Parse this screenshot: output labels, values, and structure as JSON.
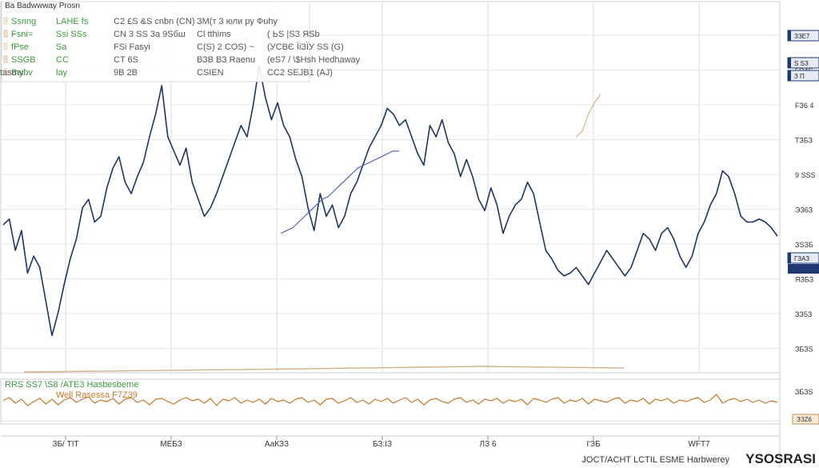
{
  "header": {
    "title": "Ba Badwwway Prosn",
    "legend_rows": [
      [
        "Ssnng",
        "LAHE fs",
        "C2 £S &S cnbn (CN)",
        "ЗМ(т 3 юли ру Фuhy"
      ],
      [
        "Fsni=",
        "Ssi SSs",
        "CN 3 SS 3a 9Sбш",
        "Cl tthims",
        "( ЬS |SЗ ЯSb"
      ],
      [
        "fPse",
        "Sa",
        "FSi Fasyi",
        "C(S) 2 COS) ~",
        "(УСВЄ ЇіЗЇУ SS (G)"
      ],
      [
        "SSGB",
        "CC",
        "CT 6S",
        "ВЗВ ВЗ Raenu",
        "(eS7 / \\$Hsh Hedhaway"
      ],
      [
        "Bsibv",
        "lay",
        "9B 2B",
        "CSIEN",
        "CC2 SEJB1 (AJ)",
        "tasmy"
      ]
    ]
  },
  "indicator": {
    "legend_line1": "RRS SS7 \\S8 /ATE3 Hasbesbeme",
    "legend_line2": "Well Rasessa F7Z39"
  },
  "footer": {
    "brand": "YSOSRASI",
    "caption": "JOCT/ACHT LCTIL ESME Harbwerey"
  },
  "colors": {
    "price": "#1d3566",
    "moving_average": "#4658b8",
    "overlay": "#d0b48c",
    "indicator": "#c27a2a",
    "legend_green": "#3c9a3c",
    "legend_gray": "#555555",
    "grid": "#d6dae0",
    "tag_navy": "#1f3a73",
    "tag_fill": "#e6eaf3",
    "indicator_tag": "#c98a4b"
  },
  "chart_data": {
    "type": "line",
    "title": "",
    "x_tick_labels": [
      "ЗБ/ TІТ",
      "МЕБЗ",
      "АаКЗЗ",
      "БЗ:ІЗ",
      "ЛЗ 6",
      "I'ЗБ",
      "WFТ7"
    ],
    "y_tick_labels": [
      "ЗЗZ6",
      "5D4S",
      "FЗ6 4",
      "ТЗБЗ",
      "9 SSS",
      "ЭЗ6З",
      "ЗSЗБ",
      "ЯЗБЗ",
      "ЗЗ5З",
      "ЗБЗS"
    ],
    "ylim": [
      0,
      100
    ],
    "right_tags": [
      "ЗЗE7",
      "S SЗ",
      "З П"
    ],
    "last_price_tag": "ГЗАЗ",
    "series": [
      {
        "name": "",
        "style": "price",
        "values": [
          49,
          51,
          40,
          47,
          32,
          38,
          34,
          22,
          10,
          18,
          28,
          37,
          44,
          55,
          58,
          50,
          52,
          62,
          69,
          73,
          64,
          60,
          66,
          71,
          80,
          88,
          98,
          80,
          75,
          70,
          76,
          64,
          58,
          52,
          55,
          60,
          66,
          72,
          78,
          84,
          80,
          91,
          105,
          94,
          86,
          92,
          84,
          80,
          72,
          66,
          55,
          47,
          60,
          52,
          56,
          48,
          52,
          60,
          64,
          70,
          76,
          80,
          84,
          90,
          88,
          84,
          86,
          80,
          74,
          70,
          84,
          80,
          86,
          78,
          74,
          66,
          72,
          66,
          58,
          54,
          62,
          56,
          46,
          52,
          56,
          58,
          64,
          60,
          50,
          40,
          37,
          33,
          31,
          32,
          34,
          31,
          28,
          32,
          36,
          40,
          37,
          34,
          31,
          34,
          40,
          46,
          44,
          40,
          46,
          48,
          44,
          38,
          34,
          38,
          46,
          50,
          56,
          60,
          68,
          66,
          60,
          52,
          50,
          50,
          51,
          50,
          48,
          45
        ]
      },
      {
        "name": "",
        "style": "moving_average",
        "values": [
          null,
          null,
          null,
          null,
          null,
          null,
          null,
          null,
          null,
          null,
          null,
          null,
          null,
          null,
          null,
          null,
          null,
          null,
          null,
          null,
          null,
          null,
          null,
          null,
          null,
          null,
          null,
          null,
          null,
          null,
          null,
          null,
          null,
          null,
          null,
          null,
          null,
          null,
          null,
          null,
          null,
          null,
          null,
          null,
          null,
          null,
          null,
          46,
          47,
          48,
          50,
          52,
          54,
          56,
          58,
          59,
          61,
          63,
          65,
          67,
          69,
          70,
          71,
          72,
          73,
          74,
          75,
          75,
          null,
          null,
          null,
          null,
          null,
          null,
          null,
          null,
          null,
          null,
          null,
          null,
          null,
          null,
          null,
          null,
          null,
          null,
          null,
          null,
          null,
          null,
          null,
          null,
          null,
          null,
          null,
          null,
          null,
          null,
          null,
          null,
          null,
          null,
          null,
          null,
          null,
          null,
          null,
          null,
          null,
          null,
          null,
          null,
          null,
          null,
          null,
          null,
          null,
          null,
          null,
          null,
          null,
          null,
          null,
          null,
          null,
          null,
          null,
          null,
          null,
          null,
          null,
          null
        ]
      },
      {
        "name": "",
        "style": "overlay",
        "values": [
          null,
          null,
          null,
          null,
          null,
          null,
          null,
          null,
          null,
          null,
          null,
          null,
          null,
          null,
          null,
          null,
          null,
          null,
          null,
          null,
          null,
          null,
          null,
          null,
          null,
          null,
          null,
          null,
          null,
          null,
          null,
          null,
          null,
          null,
          null,
          null,
          null,
          null,
          null,
          null,
          null,
          null,
          null,
          null,
          null,
          null,
          null,
          null,
          null,
          null,
          null,
          null,
          null,
          null,
          null,
          null,
          null,
          null,
          null,
          null,
          null,
          null,
          null,
          null,
          null,
          null,
          null,
          null,
          null,
          null,
          null,
          null,
          null,
          null,
          null,
          null,
          null,
          null,
          null,
          null,
          null,
          null,
          null,
          null,
          null,
          null,
          null,
          null,
          null,
          null,
          null,
          null,
          null,
          null,
          80,
          82,
          88,
          92,
          95,
          null,
          null,
          null,
          null,
          null,
          null,
          null,
          null,
          null,
          null,
          null,
          null,
          null,
          null,
          null,
          null,
          null,
          null,
          null,
          null,
          null,
          null,
          null,
          null,
          null,
          null,
          null,
          null,
          null
        ]
      },
      {
        "name": "",
        "style": "indicator",
        "values": [
          55,
          62,
          48,
          58,
          42,
          52,
          60,
          46,
          58,
          44,
          56,
          62,
          50,
          58,
          64,
          48,
          56,
          52,
          60,
          46,
          58,
          62,
          50,
          56,
          44,
          58,
          60,
          52,
          46,
          56,
          62,
          54,
          58,
          48,
          60,
          42,
          58,
          54,
          62,
          48,
          56,
          50,
          58,
          46,
          60,
          52,
          56,
          48,
          58,
          62,
          50,
          56,
          44,
          58,
          60,
          48,
          54,
          62,
          50,
          56,
          46,
          58,
          52,
          60,
          48,
          56,
          62,
          50,
          58,
          44,
          56,
          60,
          52,
          48,
          58,
          62,
          50,
          56,
          46,
          58,
          54,
          60,
          48,
          56,
          52,
          58,
          44,
          60,
          56,
          50,
          58,
          62,
          48,
          56,
          52,
          60,
          46,
          58,
          54,
          50,
          58,
          62,
          48,
          56,
          52,
          60,
          46,
          58,
          54,
          60,
          48,
          56,
          52,
          58,
          62,
          50,
          56,
          70,
          48,
          56,
          60,
          52,
          58,
          50,
          56,
          48,
          54,
          50
        ]
      }
    ]
  }
}
